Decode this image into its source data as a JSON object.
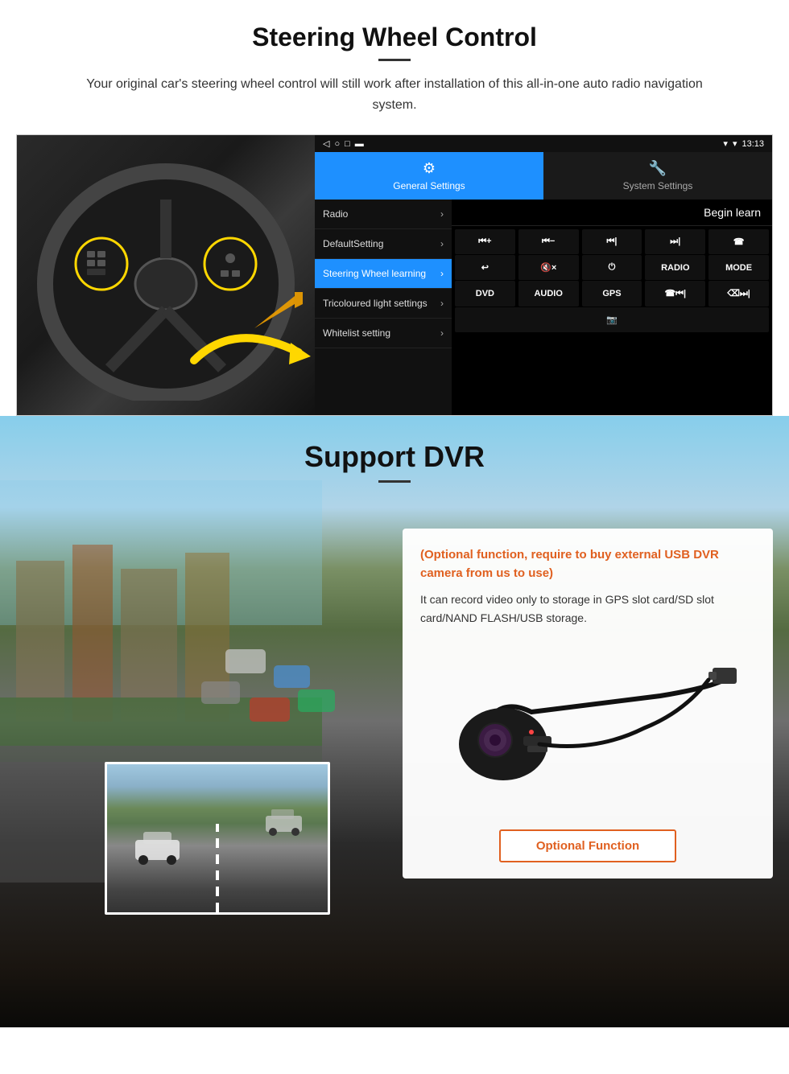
{
  "steering_section": {
    "title": "Steering Wheel Control",
    "subtitle": "Your original car's steering wheel control will still work after installation of this all-in-one auto radio navigation system.",
    "status_bar": {
      "time": "13:13",
      "signal": "▼",
      "wifi": "▾"
    },
    "tabs": [
      {
        "label": "General Settings",
        "active": true
      },
      {
        "label": "System Settings",
        "active": false
      }
    ],
    "menu_items": [
      {
        "label": "Radio",
        "active": false
      },
      {
        "label": "DefaultSetting",
        "active": false
      },
      {
        "label": "Steering Wheel learning",
        "active": true
      },
      {
        "label": "Tricoloured light settings",
        "active": false
      },
      {
        "label": "Whitelist setting",
        "active": false
      }
    ],
    "begin_learn_label": "Begin learn",
    "control_buttons": [
      [
        "⏮+",
        "⏮−",
        "⏮|",
        "⏭|",
        "☎"
      ],
      [
        "↩",
        "🔇×",
        "⏻",
        "RADIO",
        "MODE"
      ],
      [
        "DVD",
        "AUDIO",
        "GPS",
        "☎⏮|",
        "⌫⏭|"
      ],
      [
        "📷"
      ]
    ]
  },
  "dvr_section": {
    "title": "Support DVR",
    "optional_text": "(Optional function, require to buy external USB DVR camera from us to use)",
    "description": "It can record video only to storage in GPS slot card/SD slot card/NAND FLASH/USB storage.",
    "optional_button_label": "Optional Function"
  }
}
